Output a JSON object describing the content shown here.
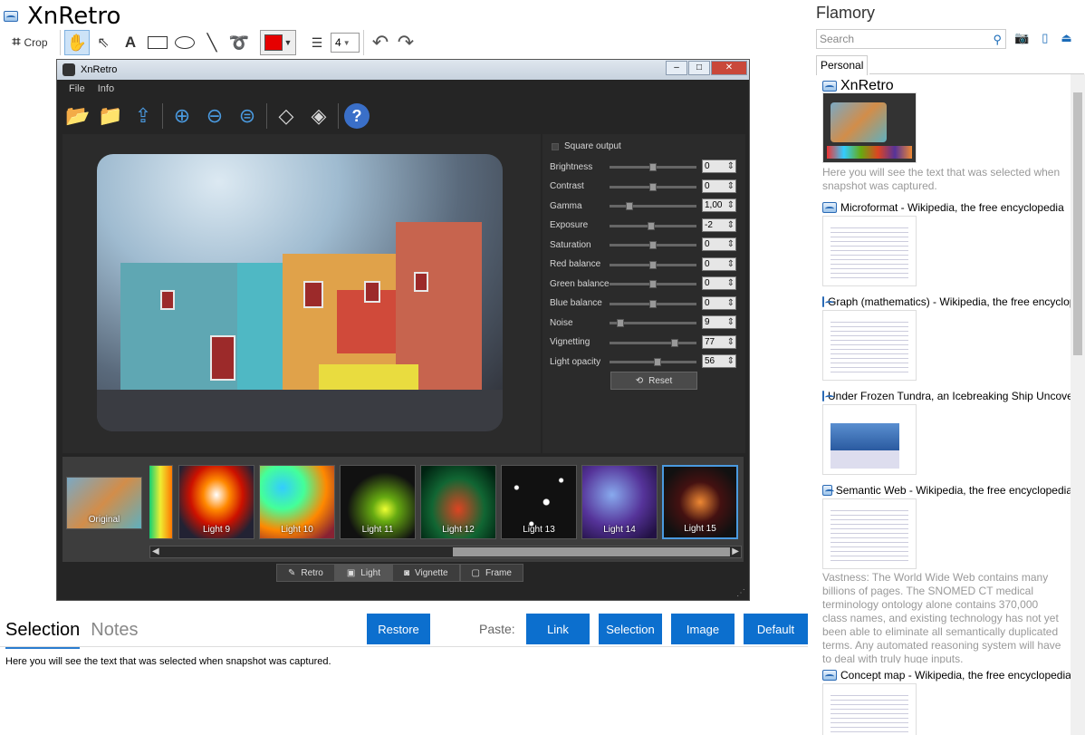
{
  "app": {
    "title": "XnRetro"
  },
  "toolbar": {
    "crop_label": "Crop",
    "color": "#e60000",
    "line_width": "4"
  },
  "xnretro": {
    "title": "XnRetro",
    "menu": [
      "File",
      "Info"
    ],
    "square_output": "Square output",
    "controls": [
      {
        "label": "Brightness",
        "value": "0",
        "pos": 0.5
      },
      {
        "label": "Contrast",
        "value": "0",
        "pos": 0.5
      },
      {
        "label": "Gamma",
        "value": "1,00",
        "pos": 0.2
      },
      {
        "label": "Exposure",
        "value": "-2",
        "pos": 0.48
      },
      {
        "label": "Saturation",
        "value": "0",
        "pos": 0.5
      },
      {
        "label": "Red balance",
        "value": "0",
        "pos": 0.5
      },
      {
        "label": "Green balance",
        "value": "0",
        "pos": 0.5
      },
      {
        "label": "Blue balance",
        "value": "0",
        "pos": 0.5
      },
      {
        "label": "Noise",
        "value": "9",
        "pos": 0.09
      },
      {
        "label": "Vignetting",
        "value": "77",
        "pos": 0.77
      },
      {
        "label": "Light opacity",
        "value": "56",
        "pos": 0.56
      }
    ],
    "reset_label": "Reset",
    "original_label": "Original",
    "thumbs": [
      "Light 9",
      "Light 10",
      "Light 11",
      "Light 12",
      "Light 13",
      "Light 14",
      "Light 15"
    ],
    "tabs": [
      "Retro",
      "Light",
      "Vignette",
      "Frame"
    ],
    "active_tab": "Light"
  },
  "bottom": {
    "tab_selection": "Selection",
    "tab_notes": "Notes",
    "restore": "Restore",
    "paste_label": "Paste:",
    "link": "Link",
    "selection": "Selection",
    "image": "Image",
    "default": "Default",
    "body_text": "Here you will see the text that was selected when snapshot was captured."
  },
  "flamory": {
    "title": "Flamory",
    "search_placeholder": "Search",
    "tab": "Personal",
    "items": [
      {
        "title": "XnRetro",
        "text": "Here you will see the text that was selected when snapshot was captured."
      },
      {
        "title": "Microformat - Wikipedia, the free encyclopedia"
      },
      {
        "title": "Graph (mathematics) - Wikipedia, the free encyclopedia"
      },
      {
        "title": "Under Frozen Tundra, an Icebreaking Ship Uncovers"
      },
      {
        "title": "Semantic Web - Wikipedia, the free encyclopedia",
        "text": "Vastness: The World Wide Web contains many billions of pages. The SNOMED CT medical terminology ontology alone contains 370,000 class names, and existing technology has not yet been able to eliminate all semantically duplicated terms. Any automated reasoning system will have to deal with truly huge inputs."
      },
      {
        "title": "Concept map - Wikipedia, the free encyclopedia"
      }
    ]
  }
}
